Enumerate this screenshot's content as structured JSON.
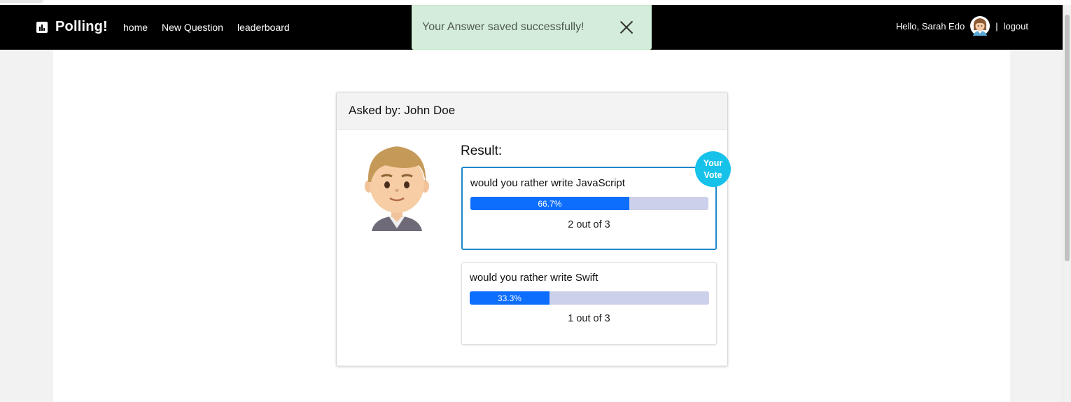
{
  "navbar": {
    "brand": "Polling!",
    "brand_icon": "bar-chart-icon",
    "links": [
      "home",
      "New Question",
      "leaderboard"
    ],
    "greeting": "Hello, Sarah Edo",
    "separator": "|",
    "logout": "logout"
  },
  "toast": {
    "message": "Your Answer saved successfully!",
    "close_icon": "close-icon"
  },
  "question": {
    "asked_by": "Asked by: John Doe",
    "result_title": "Result:",
    "badge": [
      "Your",
      "Vote"
    ],
    "options": [
      {
        "text": "would you rather write JavaScript",
        "percent_label": "66.7%",
        "percent": 66.7,
        "count_label": "2 out of 3",
        "voted": true
      },
      {
        "text": "would you rather write Swift",
        "percent_label": "33.3%",
        "percent": 33.3,
        "count_label": "1 out of 3",
        "voted": false
      }
    ]
  },
  "colors": {
    "navbar": "#000000",
    "toast_bg": "#d4edda",
    "progress_fill": "#0d6efd",
    "progress_track": "#cdd0ea",
    "voted_border": "#1e88c9",
    "badge": "#16c2ea"
  }
}
